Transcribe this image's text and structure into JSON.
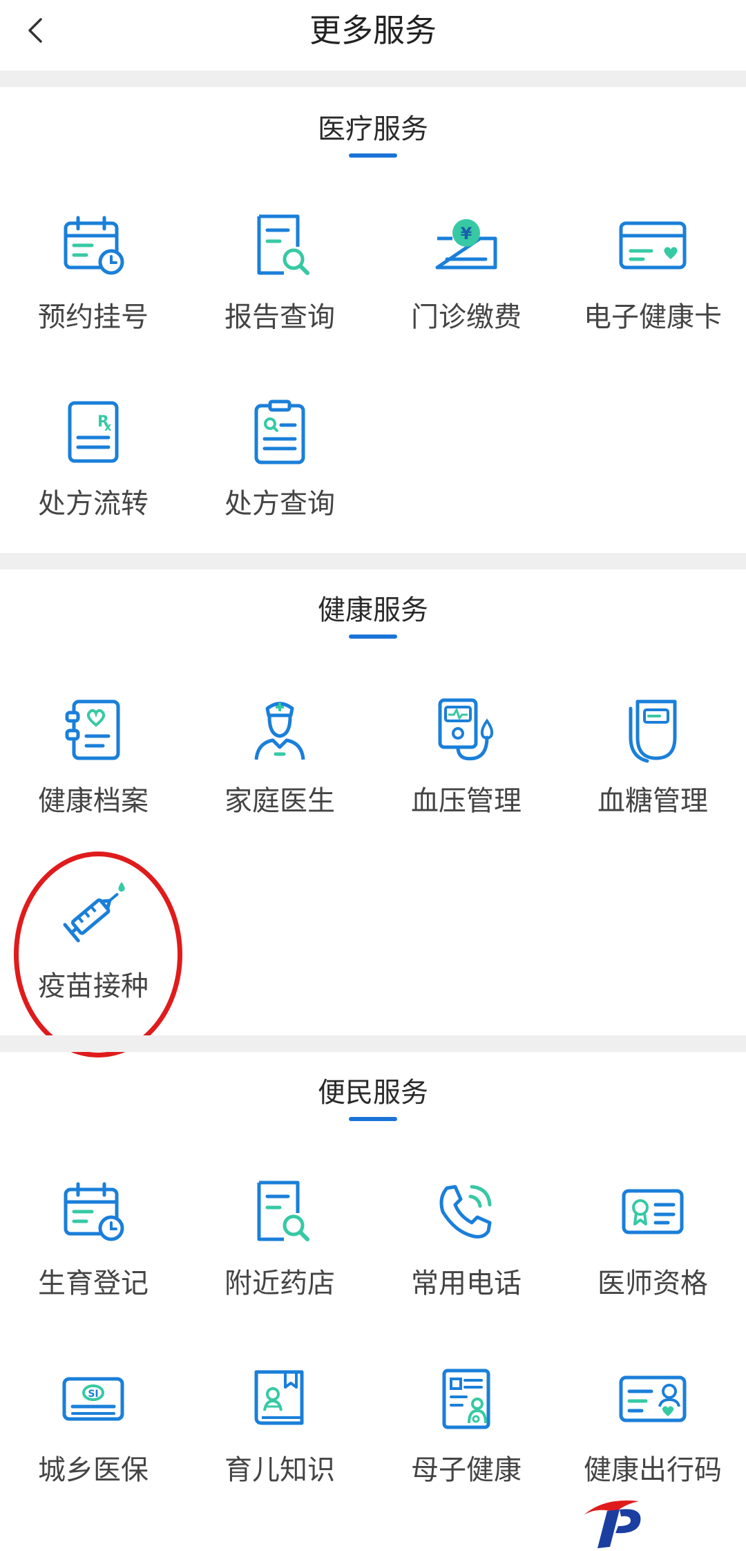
{
  "header": {
    "title": "更多服务",
    "back_icon": "chevron-left-icon"
  },
  "colors": {
    "accent": "#1a73d6",
    "icon_blue": "#1a7fd9",
    "icon_green": "#36c9a4",
    "highlight": "#e01b1b",
    "divider": "#efefef"
  },
  "sections": [
    {
      "title": "医疗服务",
      "items": [
        {
          "label": "预约挂号",
          "icon": "calendar-clock-icon"
        },
        {
          "label": "报告查询",
          "icon": "document-search-icon"
        },
        {
          "label": "门诊缴费",
          "icon": "yuan-payment-icon"
        },
        {
          "label": "电子健康卡",
          "icon": "health-card-icon"
        },
        {
          "label": "处方流转",
          "icon": "prescription-rx-icon"
        },
        {
          "label": "处方查询",
          "icon": "clipboard-search-icon"
        }
      ]
    },
    {
      "title": "健康服务",
      "items": [
        {
          "label": "健康档案",
          "icon": "health-record-icon"
        },
        {
          "label": "家庭医生",
          "icon": "doctor-icon"
        },
        {
          "label": "血压管理",
          "icon": "blood-pressure-icon"
        },
        {
          "label": "血糖管理",
          "icon": "glucose-meter-icon"
        },
        {
          "label": "疫苗接种",
          "icon": "syringe-icon"
        }
      ]
    },
    {
      "title": "便民服务",
      "items": [
        {
          "label": "生育登记",
          "icon": "calendar-clock-icon"
        },
        {
          "label": "附近药店",
          "icon": "document-search-icon"
        },
        {
          "label": "常用电话",
          "icon": "phone-icon"
        },
        {
          "label": "医师资格",
          "icon": "certificate-icon"
        },
        {
          "label": "城乡医保",
          "icon": "insurance-card-icon"
        },
        {
          "label": "育儿知识",
          "icon": "baby-book-icon"
        },
        {
          "label": "母子健康",
          "icon": "mother-child-icon"
        },
        {
          "label": "健康出行码",
          "icon": "id-card-icon"
        }
      ]
    }
  ]
}
